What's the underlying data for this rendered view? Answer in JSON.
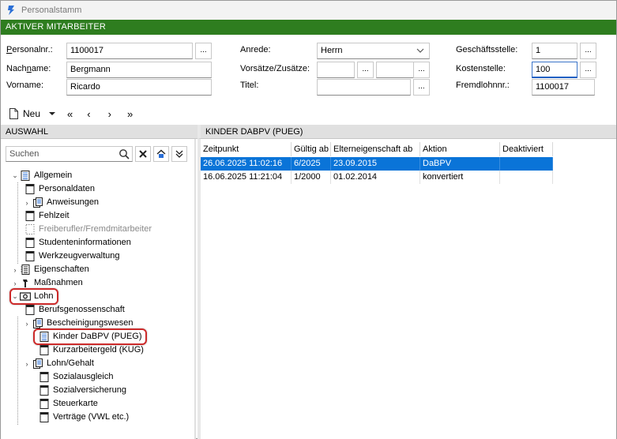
{
  "window": {
    "title": "Personalstamm",
    "banner": "AKTIVER MITARBEITER"
  },
  "form": {
    "personalnr_label_prefix": "P",
    "personalnr_label_rest": "ersonalnr.:",
    "personalnr_value": "1100017",
    "nachname_label_prefix": "Nach",
    "nachname_label_u": "n",
    "nachname_label_rest": "ame:",
    "nachname_value": "Bergmann",
    "vorname_label": "Vorname:",
    "vorname_value": "Ricardo",
    "anrede_label": "Anrede:",
    "anrede_value": "Herrn",
    "vorsaetze_label": "Vorsätze/Zusätze:",
    "titel_label": "Titel:",
    "geschaeftsstelle_label": "Geschäftsstelle:",
    "geschaeftsstelle_value": "1",
    "kostenstelle_label": "Kostenstelle:",
    "kostenstelle_value": "100",
    "fremdlohnnr_label": "Fremdlohnnr.:",
    "fremdlohnnr_value": "1100017",
    "dots": "..."
  },
  "toolbar": {
    "new_label": "Neu",
    "first": "«",
    "prev": "‹",
    "next": "›",
    "last": "»"
  },
  "left_header": "AUSWAHL",
  "right_header": "KINDER DABPV (PUEG)",
  "search_placeholder": "Suchen",
  "tree": [
    {
      "label": "Allgemein",
      "expanded": true,
      "level": 0,
      "icon": "category-icon"
    },
    {
      "label": "Personaldaten",
      "level": 1,
      "icon": "form-icon"
    },
    {
      "label": "Anweisungen",
      "level": 1,
      "icon": "folder-form-icon",
      "collapsed": true
    },
    {
      "label": "Fehlzeit",
      "level": 1,
      "icon": "form-icon"
    },
    {
      "label": "Freiberufler/Fremdmitarbeiter",
      "level": 1,
      "icon": "dotted-form-icon",
      "disabled": true
    },
    {
      "label": "Studenteninformationen",
      "level": 1,
      "icon": "form-icon"
    },
    {
      "label": "Werkzeugverwaltung",
      "level": 1,
      "icon": "form-icon"
    },
    {
      "label": "Eigenschaften",
      "level": 0,
      "icon": "properties-icon",
      "collapsed": true
    },
    {
      "label": "Maßnahmen",
      "level": 0,
      "icon": "hammer-icon",
      "collapsed": true
    },
    {
      "label": "Lohn",
      "level": 0,
      "icon": "money-icon",
      "expanded": true
    },
    {
      "label": "Berufsgenossenschaft",
      "level": 1,
      "icon": "form-icon"
    },
    {
      "label": "Bescheinigungswesen",
      "level": 1,
      "icon": "folder-form-icon",
      "collapsed": true
    },
    {
      "label": "Kinder DaBPV (PUEG)",
      "level": 1,
      "icon": "form-list-icon"
    },
    {
      "label": "Kurzarbeitergeld (KUG)",
      "level": 1,
      "icon": "form-icon"
    },
    {
      "label": "Lohn/Gehalt",
      "level": 1,
      "icon": "folder-form-icon",
      "collapsed": true
    },
    {
      "label": "Sozialausgleich",
      "level": 1,
      "icon": "form-icon"
    },
    {
      "label": "Sozialversicherung",
      "level": 1,
      "icon": "form-icon"
    },
    {
      "label": "Steuerkarte",
      "level": 1,
      "icon": "form-icon"
    },
    {
      "label": "Verträge (VWL etc.)",
      "level": 1,
      "icon": "form-icon"
    }
  ],
  "grid": {
    "columns": [
      "Zeitpunkt",
      "Gültig ab",
      "Elterneigenschaft ab",
      "Aktion",
      "Deaktiviert"
    ],
    "rows": [
      [
        "26.06.2025 11:02:16",
        "6/2025",
        "23.09.2015",
        "DaBPV",
        ""
      ],
      [
        "16.06.2025 11:21:04",
        "1/2000",
        "01.02.2014",
        "konvertiert",
        ""
      ]
    ]
  },
  "colors": {
    "banner_green": "#2e7d1f",
    "selection_blue": "#0a74d8",
    "highlight_red": "#cc2a2a"
  }
}
